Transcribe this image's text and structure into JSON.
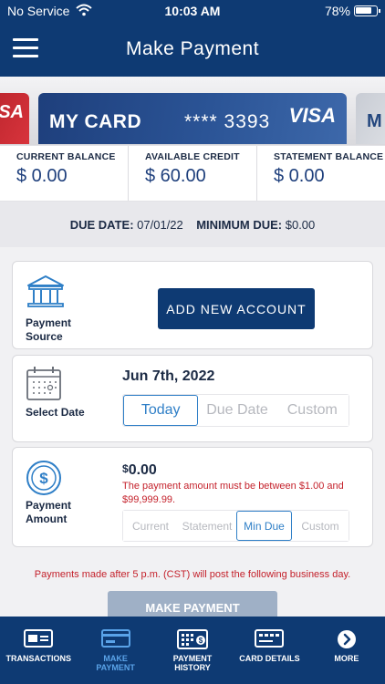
{
  "status_bar": {
    "carrier": "No Service",
    "time": "10:03 AM",
    "battery": "78%"
  },
  "header": {
    "title": "Make Payment"
  },
  "cards": {
    "left_fragment": "SA",
    "main": {
      "name": "MY CARD",
      "number": "**** 3393",
      "brand": "VISA"
    },
    "right_fragment": "M"
  },
  "balances": [
    {
      "label": "CURRENT BALANCE",
      "value": "$ 0.00"
    },
    {
      "label": "AVAILABLE CREDIT",
      "value": "$ 60.00"
    },
    {
      "label": "STATEMENT BALANCE",
      "value": "$ 0.00"
    }
  ],
  "due": {
    "due_date_label": "DUE DATE:",
    "due_date": "07/01/22",
    "min_due_label": "MINIMUM DUE:",
    "min_due": "$0.00"
  },
  "payment_source": {
    "label_line1": "Payment",
    "label_line2": "Source",
    "button": "ADD NEW ACCOUNT"
  },
  "select_date": {
    "label": "Select Date",
    "date": "Jun 7th, 2022",
    "options": [
      "Today",
      "Due Date",
      "Custom"
    ],
    "selected": "Today"
  },
  "payment_amount": {
    "label_line1": "Payment",
    "label_line2": "Amount",
    "currency": "$",
    "amount": "0.00",
    "note": "The payment amount must be between $1.00 and $99,999.99.",
    "options": [
      "Current",
      "Statement",
      "Min Due",
      "Custom"
    ],
    "selected": "Min Due"
  },
  "notice": "Payments made after 5 p.m. (CST) will post the following business day.",
  "make_payment_button": "MAKE PAYMENT",
  "nav": [
    {
      "line1": "TRANSACTIONS",
      "line2": "",
      "icon": "transactions-icon"
    },
    {
      "line1": "MAKE",
      "line2": "PAYMENT",
      "icon": "make-payment-icon"
    },
    {
      "line1": "PAYMENT",
      "line2": "HISTORY",
      "icon": "payment-history-icon"
    },
    {
      "line1": "CARD DETAILS",
      "line2": "",
      "icon": "card-details-icon"
    },
    {
      "line1": "MORE",
      "line2": "",
      "icon": "more-icon"
    }
  ],
  "colors": {
    "primary": "#0e3a73",
    "accent": "#2f7fc7",
    "error": "#c4212b",
    "nav_active": "#5aa3e8"
  }
}
